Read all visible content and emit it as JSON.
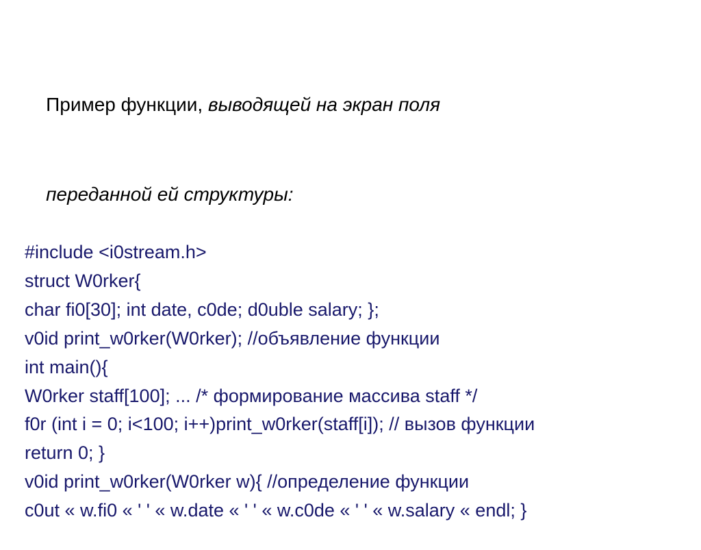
{
  "heading": {
    "plain": "Пример функции, ",
    "italic_line1": "выводящей на экран поля",
    "italic_line2": "переданной ей структуры:"
  },
  "code": {
    "l1": "#include <i0stream.h>",
    "l2": "struct W0rker{",
    "l3": "char fi0[30]; int date, c0de; d0uble salary; };",
    "l4": "v0id print_w0rker(W0rker); //объявление функции",
    "l5": "int main(){",
    "l6": "W0rker staff[100]; ... /* формирование массива staff */",
    "l7": "f0r (int i = 0; i<100; i++)print_w0rker(staff[i]); // вызов функции",
    "l8": "return 0; }",
    "l9": "v0id print_w0rker(W0rker w){ //определение функции",
    "l10": "c0ut « w.fi0 « ' ' « w.date « ' ' « w.c0de « ' ' « w.salary « endl; }"
  }
}
